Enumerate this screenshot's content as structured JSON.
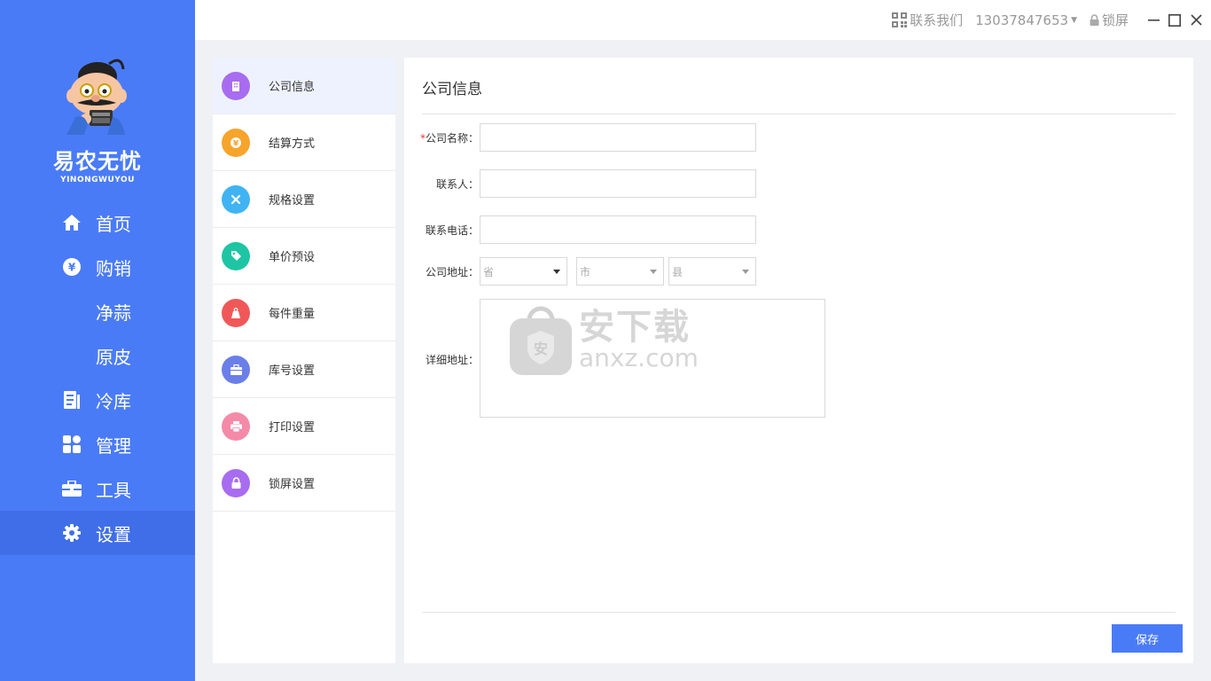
{
  "app": {
    "name": "易农无忧",
    "name_en": "YINONGWUYOU"
  },
  "topbar": {
    "contact_label": "联系我们",
    "phone": "13037847653",
    "lock_label": "锁屏"
  },
  "nav": {
    "items": [
      {
        "label": "首页",
        "icon": "home-icon"
      },
      {
        "label": "购销",
        "icon": "yen-circle-icon"
      },
      {
        "label": "净蒜",
        "icon": ""
      },
      {
        "label": "原皮",
        "icon": ""
      },
      {
        "label": "冷库",
        "icon": "document-icon"
      },
      {
        "label": "管理",
        "icon": "grid-icon"
      },
      {
        "label": "工具",
        "icon": "toolbox-icon"
      },
      {
        "label": "设置",
        "icon": "gear-icon"
      }
    ],
    "active": "设置"
  },
  "settings_menu": {
    "items": [
      {
        "label": "公司信息",
        "color": "#a86cf0"
      },
      {
        "label": "结算方式",
        "color": "#f7a42a"
      },
      {
        "label": "规格设置",
        "color": "#40b4f2"
      },
      {
        "label": "单价预设",
        "color": "#1ec5a4"
      },
      {
        "label": "每件重量",
        "color": "#f05858"
      },
      {
        "label": "库号设置",
        "color": "#6b7fe8"
      },
      {
        "label": "打印设置",
        "color": "#f48aa8"
      },
      {
        "label": "锁屏设置",
        "color": "#a86cf0"
      }
    ],
    "active": "公司信息"
  },
  "form": {
    "title": "公司信息",
    "required_mark": "*",
    "company_name_label": "公司名称：",
    "contact_label": "联系人：",
    "phone_label": "联系电话：",
    "address_label": "公司地址：",
    "province_placeholder": "省",
    "city_placeholder": "市",
    "county_placeholder": "县",
    "detail_label": "详细地址：",
    "save_label": "保存"
  },
  "watermark": {
    "cn": "安下载",
    "en": "anxz.com"
  },
  "colors": {
    "primary": "#4a7bf7",
    "sidebar_active": "#3f6ee8",
    "menu_active": "#eef2fe"
  }
}
